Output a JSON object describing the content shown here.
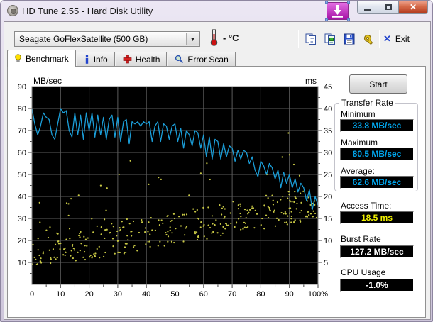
{
  "window": {
    "title": "HD Tune 2.55 - Hard Disk Utility"
  },
  "titlebar": {
    "minimize": "minimize",
    "maximize": "maximize",
    "close": "close",
    "close_glyph": "✕"
  },
  "toolbar": {
    "drive_select": "Seagate GoFlexSatellite (500 GB)",
    "temperature": "- °C",
    "exit_label": "Exit",
    "exit_glyph": "✕"
  },
  "tabs": [
    {
      "label": "Benchmark",
      "active": true
    },
    {
      "label": "Info",
      "active": false
    },
    {
      "label": "Health",
      "active": false
    },
    {
      "label": "Error Scan",
      "active": false
    }
  ],
  "panel": {
    "start_label": "Start",
    "transfer_rate": {
      "legend": "Transfer Rate",
      "minimum_label": "Minimum",
      "minimum": "33.8 MB/sec",
      "maximum_label": "Maximum",
      "maximum": "80.5 MB/sec",
      "average_label": "Average:",
      "average": "62.6 MB/sec"
    },
    "access_time_label": "Access Time:",
    "access_time": "18.5 ms",
    "burst_rate_label": "Burst Rate",
    "burst_rate": "127.2 MB/sec",
    "cpu_usage_label": "CPU Usage",
    "cpu_usage": "-1.0%"
  },
  "colors": {
    "line": "#1b9ed8",
    "scatter": "#c8c845",
    "value_cyan": "#00a8f0",
    "value_yellow": "#f0f000",
    "value_white": "#ffffff",
    "plot_bg": "#000000",
    "grid": "#5c5c5c",
    "plot_border": "#8a8a8a"
  },
  "chart_data": {
    "type": "line",
    "title": "HD Tune benchmark graph",
    "left_axis": {
      "label": "MB/sec",
      "min": 0,
      "max": 90,
      "major_ticks": [
        90,
        80,
        70,
        60,
        50,
        40,
        30,
        20,
        10
      ],
      "minor_step": 5
    },
    "right_axis": {
      "label": "ms",
      "min": 0,
      "max": 45,
      "major_ticks": [
        45,
        40,
        35,
        30,
        25,
        20,
        15,
        10,
        5
      ],
      "minor_step": 2.5
    },
    "x_axis": {
      "min": 0,
      "max": 100,
      "major_ticks": [
        0,
        10,
        20,
        30,
        40,
        50,
        60,
        70,
        80,
        90,
        100
      ],
      "last_label_suffix": "%",
      "minor_step": 5
    },
    "grid": true,
    "series": [
      {
        "name": "transfer-rate",
        "type": "line",
        "axis": "left",
        "color": "#1b9ed8",
        "x_start": 0,
        "x_step": 1,
        "values": [
          80,
          73,
          68,
          72,
          78,
          76,
          75,
          68,
          66,
          73,
          80,
          78,
          79,
          70,
          67,
          78,
          68,
          77,
          66,
          78,
          70,
          78,
          67,
          77,
          68,
          76,
          66,
          75,
          77,
          67,
          76,
          65,
          74,
          75,
          64,
          74,
          73,
          74,
          72,
          74,
          73,
          74,
          65,
          72,
          74,
          65,
          73,
          72,
          66,
          72,
          73,
          65,
          71,
          62,
          70,
          68,
          63,
          70,
          69,
          62,
          68,
          58,
          67,
          57,
          66,
          65,
          57,
          64,
          58,
          63,
          62,
          56,
          61,
          57,
          61,
          60,
          55,
          58,
          52,
          49,
          56,
          54,
          50,
          55,
          53,
          48,
          52,
          44,
          51,
          46,
          50,
          44,
          48,
          42,
          46,
          44,
          38,
          43,
          34,
          40,
          36
        ]
      },
      {
        "name": "access-time",
        "type": "scatter",
        "axis": "right",
        "color": "#c8c845",
        "seed": 987654321,
        "count": 360,
        "band": {
          "base_ms": 5.5,
          "slope_ms_per_pct": 0.115,
          "jitter_low": -2.2,
          "jitter_span": 7.5,
          "outlier_prob": 0.1,
          "outlier_offset": 4,
          "outlier_span": 16,
          "min_ms": 1.5,
          "max_ms": 42
        }
      }
    ],
    "summary": {
      "minimum_mb_sec": 33.8,
      "maximum_mb_sec": 80.5,
      "average_mb_sec": 62.6,
      "access_time_ms": 18.5,
      "burst_rate_mb_sec": 127.2,
      "cpu_usage_pct": -1.0
    }
  }
}
